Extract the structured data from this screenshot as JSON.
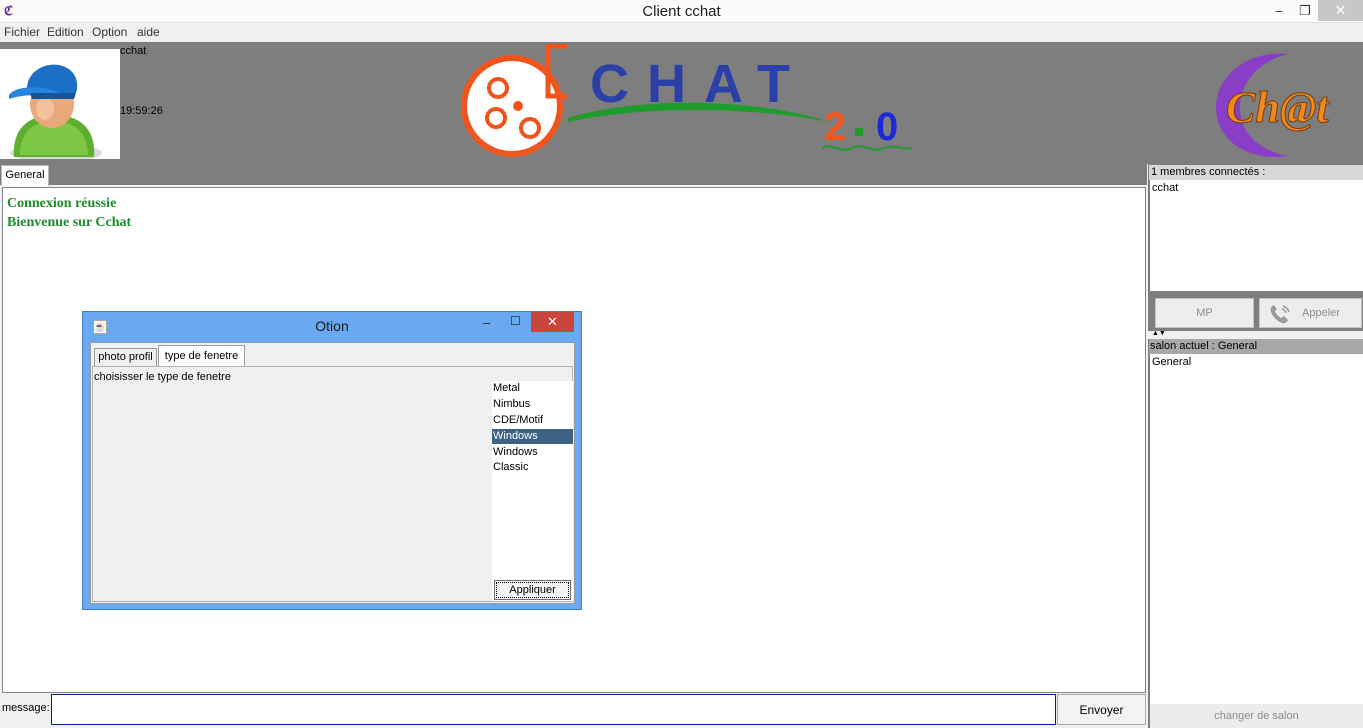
{
  "window": {
    "title": "Client cchat",
    "min_glyph": "–",
    "max_glyph": "❐",
    "close_glyph": "✕"
  },
  "menu": {
    "fichier": "Fichier",
    "edition": "Edition",
    "option": "Option",
    "aide": "aide"
  },
  "header": {
    "username": "cchat",
    "clock": "19:59:26",
    "logo_main_text": "CHAT",
    "logo_main_version_major": "2",
    "logo_main_version_minor": "0",
    "logo_side_text": "Ch@t"
  },
  "tabs": {
    "general": "General"
  },
  "chat": {
    "lines": [
      "Connexion réussie",
      "Bienvenue sur Cchat"
    ]
  },
  "message_bar": {
    "label": "message:",
    "value": "",
    "send_label": "Envoyer"
  },
  "members": {
    "header": "1 membres connectés :",
    "items": [
      "cchat"
    ],
    "mp_label": "MP",
    "call_label": "Appeler"
  },
  "room": {
    "header": "salon actuel : General",
    "items": [
      "General"
    ],
    "change_label": "changer de salon"
  },
  "dialog": {
    "title": "Otion",
    "min_glyph": "–",
    "max_glyph": "☐",
    "close_glyph": "✕",
    "tab_photo": "photo profil",
    "tab_type": "type de fenetre",
    "label": "choisisser le type de fenetre",
    "laf_options": [
      "Metal",
      "Nimbus",
      "CDE/Motif",
      "Windows",
      "Windows Classic"
    ],
    "laf_selected": "Windows",
    "apply_label": "Appliquer"
  },
  "colors": {
    "header_bg": "#7e7e7e",
    "chat_text": "#1e8a2a",
    "dialog_frame": "#6aa9f1",
    "dialog_close": "#c9463d",
    "selection": "#3d6283"
  }
}
